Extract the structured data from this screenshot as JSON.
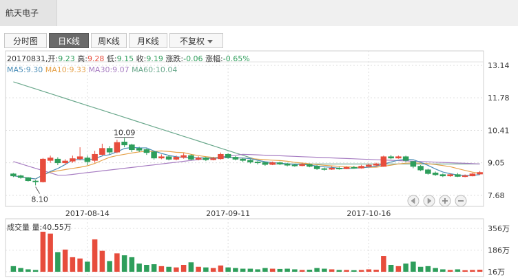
{
  "stock": {
    "name": "航天电子"
  },
  "tabs": [
    {
      "label": "分时图",
      "active": false
    },
    {
      "label": "日K线",
      "active": true
    },
    {
      "label": "周K线",
      "active": false
    },
    {
      "label": "月K线",
      "active": false
    },
    {
      "label": "不复权",
      "active": false
    }
  ],
  "info": {
    "date": "20170831,",
    "open_label": "开:",
    "open": "9.23",
    "high_label": "高:",
    "high": "9.28",
    "low_label": "低:",
    "low": "9.15",
    "close_label": "收:",
    "close": "9.19",
    "change_label": "涨跌:",
    "change": "-0.06",
    "pct_label": "涨幅:",
    "pct": "-0.65%"
  },
  "ma": {
    "ma5": "MA5:9.30",
    "ma10": "MA10:9.33",
    "ma30": "MA30:9.07",
    "ma60": "MA60:10.04"
  },
  "volume": {
    "label": "成交量 量:40.55万"
  },
  "annotations": {
    "max": "10.09",
    "min": "8.10"
  },
  "controls": [
    "left",
    "right",
    "zoom-in",
    "zoom-out"
  ],
  "colors": {
    "up": "#e74c3c",
    "down": "#2e9e5b",
    "ma5": "#4a8db7",
    "ma10": "#e6a24a",
    "ma30": "#a77dc2",
    "ma60": "#6aa88c",
    "grid": "#dcdcdc"
  },
  "chart_data": {
    "type": "candlestick",
    "price_axis": {
      "ticks": [
        "13.14",
        "11.78",
        "10.41",
        "9.05",
        "7.68"
      ],
      "ylim": [
        7.68,
        13.14
      ]
    },
    "volume_axis": {
      "ticks": [
        "356万",
        "186万",
        "16万"
      ],
      "ylim": [
        16,
        356
      ]
    },
    "date_ticks": [
      {
        "label": "2017-08-14",
        "index": 10
      },
      {
        "label": "2017-09-11",
        "index": 29
      },
      {
        "label": "2017-10-16",
        "index": 48
      }
    ],
    "candles": [
      [
        8.58,
        8.5,
        8.62,
        8.45,
        60
      ],
      [
        8.5,
        8.43,
        8.55,
        8.38,
        45
      ],
      [
        8.42,
        8.3,
        8.45,
        8.26,
        35
      ],
      [
        8.28,
        8.25,
        8.32,
        8.1,
        30
      ],
      [
        8.25,
        9.2,
        9.25,
        8.22,
        330
      ],
      [
        9.15,
        9.25,
        9.35,
        9.05,
        315
      ],
      [
        9.2,
        9.05,
        9.28,
        8.95,
        170
      ],
      [
        9.05,
        9.12,
        9.2,
        8.95,
        190
      ],
      [
        9.12,
        9.22,
        9.35,
        9.05,
        130
      ],
      [
        9.22,
        9.3,
        9.7,
        9.15,
        120
      ],
      [
        9.25,
        9.1,
        9.35,
        8.95,
        95
      ],
      [
        9.15,
        9.4,
        9.55,
        9.05,
        270
      ],
      [
        9.4,
        9.65,
        9.85,
        9.35,
        180
      ],
      [
        9.65,
        9.5,
        9.75,
        9.4,
        100
      ],
      [
        9.5,
        9.9,
        10.02,
        9.45,
        160
      ],
      [
        9.92,
        9.8,
        10.09,
        9.7,
        145
      ],
      [
        9.8,
        9.6,
        9.85,
        9.5,
        130
      ],
      [
        9.65,
        9.58,
        9.72,
        9.5,
        80
      ],
      [
        9.6,
        9.48,
        9.65,
        9.38,
        70
      ],
      [
        9.5,
        9.25,
        9.55,
        9.18,
        75
      ],
      [
        9.25,
        9.3,
        9.4,
        9.2,
        60
      ],
      [
        9.3,
        9.2,
        9.38,
        9.15,
        55
      ],
      [
        9.2,
        9.28,
        9.36,
        9.15,
        50
      ],
      [
        9.28,
        9.35,
        9.45,
        9.22,
        70
      ],
      [
        9.35,
        9.2,
        9.4,
        9.15,
        90
      ],
      [
        9.2,
        9.25,
        9.32,
        9.15,
        55
      ],
      [
        9.25,
        9.18,
        9.3,
        9.12,
        50
      ],
      [
        9.18,
        9.22,
        9.3,
        9.15,
        45
      ],
      [
        9.22,
        9.4,
        9.48,
        9.18,
        65
      ],
      [
        9.4,
        9.28,
        9.45,
        9.22,
        50
      ],
      [
        9.28,
        9.2,
        9.33,
        9.15,
        45
      ],
      [
        9.2,
        9.15,
        9.25,
        9.08,
        40
      ],
      [
        9.15,
        9.08,
        9.2,
        9.02,
        40
      ],
      [
        9.08,
        9.05,
        9.12,
        8.98,
        35
      ],
      [
        9.05,
        8.98,
        9.1,
        8.92,
        45
      ],
      [
        8.98,
        9.05,
        9.1,
        8.95,
        40
      ],
      [
        9.05,
        9.0,
        9.1,
        8.95,
        38
      ],
      [
        9.0,
        8.95,
        9.05,
        8.9,
        40
      ],
      [
        8.95,
        8.93,
        9.0,
        8.88,
        35
      ],
      [
        8.93,
        8.98,
        9.05,
        8.9,
        30
      ],
      [
        8.98,
        8.9,
        9.02,
        8.86,
        32
      ],
      [
        8.9,
        8.8,
        8.95,
        8.75,
        45
      ],
      [
        8.8,
        8.78,
        8.85,
        8.72,
        40
      ],
      [
        8.78,
        8.82,
        8.9,
        8.75,
        35
      ],
      [
        8.82,
        8.8,
        8.88,
        8.76,
        30
      ],
      [
        8.8,
        8.85,
        8.9,
        8.78,
        30
      ],
      [
        8.85,
        8.83,
        8.92,
        8.8,
        28
      ],
      [
        8.83,
        8.9,
        8.96,
        8.8,
        30
      ],
      [
        8.9,
        8.95,
        9.02,
        8.86,
        35
      ],
      [
        8.95,
        9.0,
        9.05,
        8.9,
        32
      ],
      [
        8.9,
        9.3,
        9.35,
        8.88,
        140
      ],
      [
        9.3,
        9.25,
        9.38,
        9.2,
        70
      ],
      [
        9.25,
        9.3,
        9.35,
        9.22,
        60
      ],
      [
        9.3,
        9.15,
        9.35,
        9.08,
        80
      ],
      [
        9.1,
        8.9,
        9.12,
        8.82,
        95
      ],
      [
        8.9,
        8.75,
        8.95,
        8.7,
        55
      ],
      [
        8.75,
        8.6,
        8.8,
        8.55,
        60
      ],
      [
        8.62,
        8.55,
        8.68,
        8.5,
        45
      ],
      [
        8.55,
        8.5,
        8.6,
        8.45,
        35
      ],
      [
        8.5,
        8.55,
        8.6,
        8.46,
        30
      ],
      [
        8.55,
        8.48,
        8.62,
        8.45,
        35
      ],
      [
        8.48,
        8.5,
        8.56,
        8.44,
        28
      ],
      [
        8.5,
        8.58,
        8.62,
        8.48,
        30
      ],
      [
        8.58,
        8.64,
        8.7,
        8.55,
        32
      ]
    ]
  }
}
